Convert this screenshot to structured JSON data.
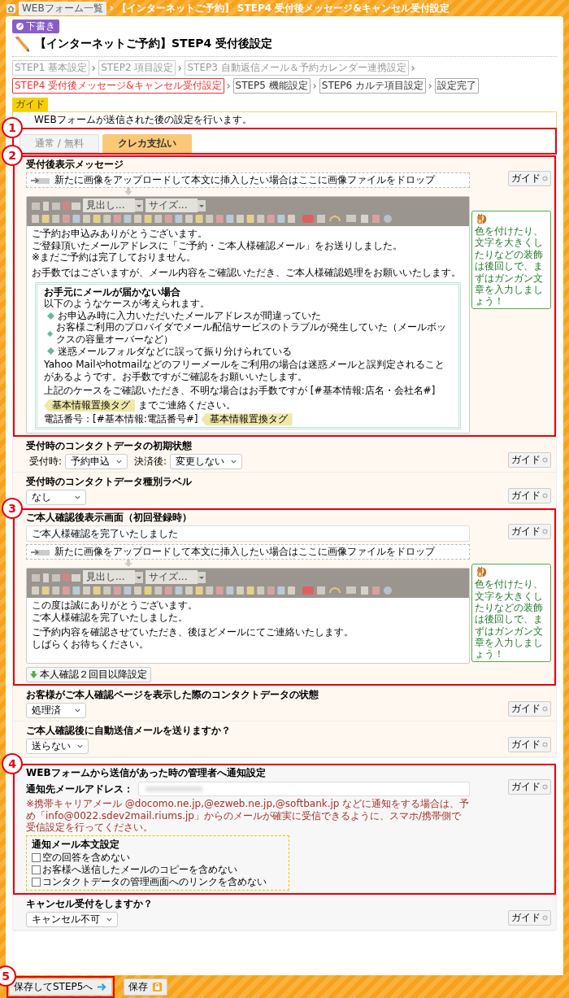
{
  "breadcrumb": {
    "home_label": "WEBフォーム一覧",
    "current": "【インターネットご予約】 STEP4 受付後メッセージ&キャンセル受付設定"
  },
  "status_badge": "下書き",
  "title": "【インターネットご予約】STEP4 受付後設定",
  "steps": [
    {
      "label": "STEP1 基本設定",
      "disabled": true,
      "selected": false
    },
    {
      "label": "STEP2 項目設定",
      "disabled": true,
      "selected": false
    },
    {
      "label": "STEP3 自動返信メール＆予約カレンダー連携設定",
      "disabled": true,
      "selected": false
    },
    {
      "label": "STEP4 受付後メッセージ&キャンセル受付設定",
      "disabled": false,
      "selected": true
    },
    {
      "label": "STEP5 機能設定",
      "disabled": false,
      "selected": false
    },
    {
      "label": "STEP6 カルテ項目設定",
      "disabled": false,
      "selected": false
    },
    {
      "label": "設定完了",
      "disabled": false,
      "selected": false
    }
  ],
  "guide": {
    "label": "ガイド",
    "text": "WEBフォームが送信された後の設定を行います。"
  },
  "tabs_marker": "1",
  "tabs": [
    {
      "label": "通常 / 無料",
      "selected": false
    },
    {
      "label": "クレカ支払い",
      "selected": true
    }
  ],
  "tab_sections": [
    {
      "kind": "editor",
      "marker": "2",
      "title": "受付後表示メッセージ",
      "guide_button": "ガイド",
      "dropzone": "新たに画像をアップロードして本文に挿入したい場合はここに画像ファイルをドロップ",
      "toolbar": {
        "heading": "見出し...",
        "size": "サイズ..."
      },
      "paragraphs": [
        [
          "ご予約お申込みありがとうございます。",
          "ご登録頂いたメールアドレスに「ご予約・ご本人様確認メール」をお送りしました。",
          "※まだご予約は完了しておりません。"
        ],
        [
          "お手数ではございますが、メール内容をご確認いただき、ご本人様確認処理をお願いいたします。"
        ]
      ],
      "notice": {
        "title": "お手元にメールが届かない場合",
        "intro": "以下のようなケースが考えられます。",
        "bullets": [
          "お申込み時に入力いただいたメールアドレスが間違っていた",
          "お客様ご利用のプロバイダでメール配信サービスのトラブルが発生していた（メールボックスの容量オーバーなど）",
          "迷惑メールフォルダなどに誤って振り分けられている"
        ],
        "text": "Yahoo Mailやhotmailなどのフリーメールをご利用の場合は迷惑メールと誤判定されることがあるようです。お手数ですがご確認をお願いいたします。",
        "tag_lines": [
          {
            "text": "上記のケースをご確認いただき、不明な場合はお手数ですが [#基本情報:店名・会社名#]",
            "tag": "基本情報置換タグ",
            "after": "までご連絡ください。"
          },
          {
            "text": "電話番号：[#基本情報:電話番号#]",
            "tag": "基本情報置換タグ"
          }
        ]
      },
      "tip": "色を付けたり、文字を大きくしたりなどの装飾は後回しで、まずはガンガン文章を入力しましょう！"
    },
    {
      "kind": "selects",
      "title": "受付時のコンタクトデータの初期状態",
      "guide_button": "ガイド",
      "selects": [
        {
          "label": "受付時:",
          "value": "予約申込"
        },
        {
          "label": "決済後:",
          "value": "変更しない"
        }
      ]
    },
    {
      "kind": "selects",
      "title": "受付時のコンタクトデータ種別ラベル",
      "guide_button": "ガイド",
      "selects": [
        {
          "value": "なし"
        }
      ]
    },
    {
      "kind": "editor",
      "marker": "3",
      "title": "ご本人確認後表示画面（初回登録時）",
      "guide_button": "ガイド",
      "subject": "ご本人様確認を完了いたしました",
      "dropzone": "新たに画像をアップロードして本文に挿入したい場合はここに画像ファイルをドロップ",
      "toolbar": {
        "heading": "見出し...",
        "size": "サイズ..."
      },
      "paragraphs": [
        [
          "この度は誠にありがとうございます。",
          "ご本人様確認を完了いたしました。"
        ],
        [
          "ご予約内容を確認させていただき、後ほどメールにてご連絡いたします。",
          "しばらくお待ちください。"
        ]
      ],
      "tip": "色を付けたり、文字を大きくしたりなどの装飾は後回しで、まずはガンガン文章を入力しましょう！",
      "extra_button": "本人確認２回目以降設定"
    },
    {
      "kind": "selects",
      "title": "お客様がご本人確認ページを表示した際のコンタクトデータの状態",
      "guide_button": "ガイド",
      "selects": [
        {
          "value": "処理済"
        }
      ]
    },
    {
      "kind": "selects",
      "title": "ご本人確認後に自動送信メールを送りますか？",
      "guide_button": "ガイド",
      "selects": [
        {
          "value": "送らない"
        }
      ]
    }
  ],
  "common_sections": [
    {
      "kind": "notify",
      "marker": "4",
      "title": "WEBフォームから送信があった時の管理者へ通知設定",
      "guide_button": "ガイド",
      "email_label": "通知先メールアドレス：",
      "note": "※携帯キャリアメール @docomo.ne.jp,@ezweb.ne.jp,@softbank.jp などに通知をする場合は、予め「info@0022.sdev2mail.riums.jp」からのメールが確実に受信できるように、スマホ/携帯側で受信設定を行ってください。",
      "options_title": "通知メール本文設定",
      "options": [
        {
          "label": "空の回答を含めない",
          "checked": false
        },
        {
          "label": "お客様へ送信したメールのコピーを含めない",
          "checked": false
        },
        {
          "label": "コンタクトデータの管理画面へのリンクを含めない",
          "checked": false
        }
      ]
    },
    {
      "kind": "selects",
      "title": "キャンセル受付をしますか？",
      "guide_button": "ガイド",
      "selects": [
        {
          "value": "キャンセル不可"
        }
      ]
    }
  ],
  "footer_buttons": [
    {
      "kind": "next",
      "label": "保存してSTEP5へ",
      "marker": "5"
    },
    {
      "kind": "save",
      "label": "保存"
    }
  ]
}
